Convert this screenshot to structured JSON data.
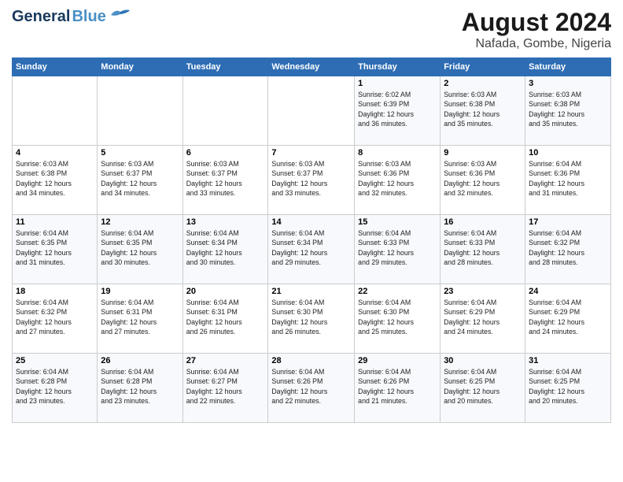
{
  "logo": {
    "part1": "General",
    "part2": "Blue"
  },
  "title": "August 2024",
  "subtitle": "Nafada, Gombe, Nigeria",
  "weekdays": [
    "Sunday",
    "Monday",
    "Tuesday",
    "Wednesday",
    "Thursday",
    "Friday",
    "Saturday"
  ],
  "weeks": [
    [
      {
        "day": "",
        "info": ""
      },
      {
        "day": "",
        "info": ""
      },
      {
        "day": "",
        "info": ""
      },
      {
        "day": "",
        "info": ""
      },
      {
        "day": "1",
        "info": "Sunrise: 6:02 AM\nSunset: 6:39 PM\nDaylight: 12 hours\nand 36 minutes."
      },
      {
        "day": "2",
        "info": "Sunrise: 6:03 AM\nSunset: 6:38 PM\nDaylight: 12 hours\nand 35 minutes."
      },
      {
        "day": "3",
        "info": "Sunrise: 6:03 AM\nSunset: 6:38 PM\nDaylight: 12 hours\nand 35 minutes."
      }
    ],
    [
      {
        "day": "4",
        "info": "Sunrise: 6:03 AM\nSunset: 6:38 PM\nDaylight: 12 hours\nand 34 minutes."
      },
      {
        "day": "5",
        "info": "Sunrise: 6:03 AM\nSunset: 6:37 PM\nDaylight: 12 hours\nand 34 minutes."
      },
      {
        "day": "6",
        "info": "Sunrise: 6:03 AM\nSunset: 6:37 PM\nDaylight: 12 hours\nand 33 minutes."
      },
      {
        "day": "7",
        "info": "Sunrise: 6:03 AM\nSunset: 6:37 PM\nDaylight: 12 hours\nand 33 minutes."
      },
      {
        "day": "8",
        "info": "Sunrise: 6:03 AM\nSunset: 6:36 PM\nDaylight: 12 hours\nand 32 minutes."
      },
      {
        "day": "9",
        "info": "Sunrise: 6:03 AM\nSunset: 6:36 PM\nDaylight: 12 hours\nand 32 minutes."
      },
      {
        "day": "10",
        "info": "Sunrise: 6:04 AM\nSunset: 6:36 PM\nDaylight: 12 hours\nand 31 minutes."
      }
    ],
    [
      {
        "day": "11",
        "info": "Sunrise: 6:04 AM\nSunset: 6:35 PM\nDaylight: 12 hours\nand 31 minutes."
      },
      {
        "day": "12",
        "info": "Sunrise: 6:04 AM\nSunset: 6:35 PM\nDaylight: 12 hours\nand 30 minutes."
      },
      {
        "day": "13",
        "info": "Sunrise: 6:04 AM\nSunset: 6:34 PM\nDaylight: 12 hours\nand 30 minutes."
      },
      {
        "day": "14",
        "info": "Sunrise: 6:04 AM\nSunset: 6:34 PM\nDaylight: 12 hours\nand 29 minutes."
      },
      {
        "day": "15",
        "info": "Sunrise: 6:04 AM\nSunset: 6:33 PM\nDaylight: 12 hours\nand 29 minutes."
      },
      {
        "day": "16",
        "info": "Sunrise: 6:04 AM\nSunset: 6:33 PM\nDaylight: 12 hours\nand 28 minutes."
      },
      {
        "day": "17",
        "info": "Sunrise: 6:04 AM\nSunset: 6:32 PM\nDaylight: 12 hours\nand 28 minutes."
      }
    ],
    [
      {
        "day": "18",
        "info": "Sunrise: 6:04 AM\nSunset: 6:32 PM\nDaylight: 12 hours\nand 27 minutes."
      },
      {
        "day": "19",
        "info": "Sunrise: 6:04 AM\nSunset: 6:31 PM\nDaylight: 12 hours\nand 27 minutes."
      },
      {
        "day": "20",
        "info": "Sunrise: 6:04 AM\nSunset: 6:31 PM\nDaylight: 12 hours\nand 26 minutes."
      },
      {
        "day": "21",
        "info": "Sunrise: 6:04 AM\nSunset: 6:30 PM\nDaylight: 12 hours\nand 26 minutes."
      },
      {
        "day": "22",
        "info": "Sunrise: 6:04 AM\nSunset: 6:30 PM\nDaylight: 12 hours\nand 25 minutes."
      },
      {
        "day": "23",
        "info": "Sunrise: 6:04 AM\nSunset: 6:29 PM\nDaylight: 12 hours\nand 24 minutes."
      },
      {
        "day": "24",
        "info": "Sunrise: 6:04 AM\nSunset: 6:29 PM\nDaylight: 12 hours\nand 24 minutes."
      }
    ],
    [
      {
        "day": "25",
        "info": "Sunrise: 6:04 AM\nSunset: 6:28 PM\nDaylight: 12 hours\nand 23 minutes."
      },
      {
        "day": "26",
        "info": "Sunrise: 6:04 AM\nSunset: 6:28 PM\nDaylight: 12 hours\nand 23 minutes."
      },
      {
        "day": "27",
        "info": "Sunrise: 6:04 AM\nSunset: 6:27 PM\nDaylight: 12 hours\nand 22 minutes."
      },
      {
        "day": "28",
        "info": "Sunrise: 6:04 AM\nSunset: 6:26 PM\nDaylight: 12 hours\nand 22 minutes."
      },
      {
        "day": "29",
        "info": "Sunrise: 6:04 AM\nSunset: 6:26 PM\nDaylight: 12 hours\nand 21 minutes."
      },
      {
        "day": "30",
        "info": "Sunrise: 6:04 AM\nSunset: 6:25 PM\nDaylight: 12 hours\nand 20 minutes."
      },
      {
        "day": "31",
        "info": "Sunrise: 6:04 AM\nSunset: 6:25 PM\nDaylight: 12 hours\nand 20 minutes."
      }
    ]
  ]
}
